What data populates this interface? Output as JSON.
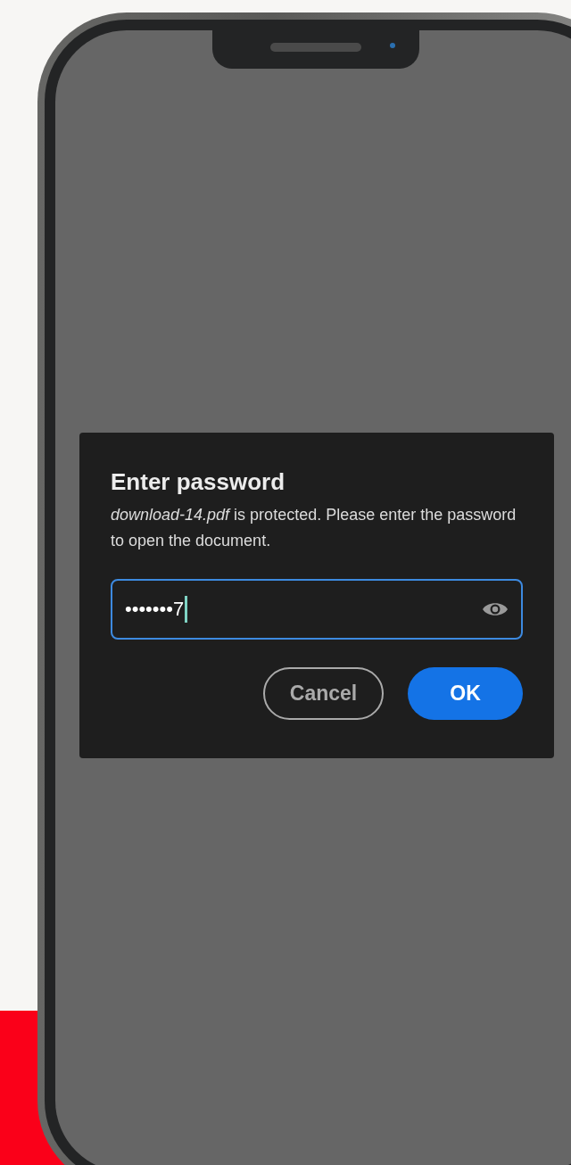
{
  "dialog": {
    "title": "Enter password",
    "message": "*download-14.pdf* is protected. Please enter the password to open the document.",
    "password_field": {
      "value": "•••••••7",
      "focused": true
    },
    "buttons": [
      {
        "label": "Cancel",
        "kind": "secondary"
      },
      {
        "label": "OK",
        "kind": "primary"
      }
    ]
  }
}
